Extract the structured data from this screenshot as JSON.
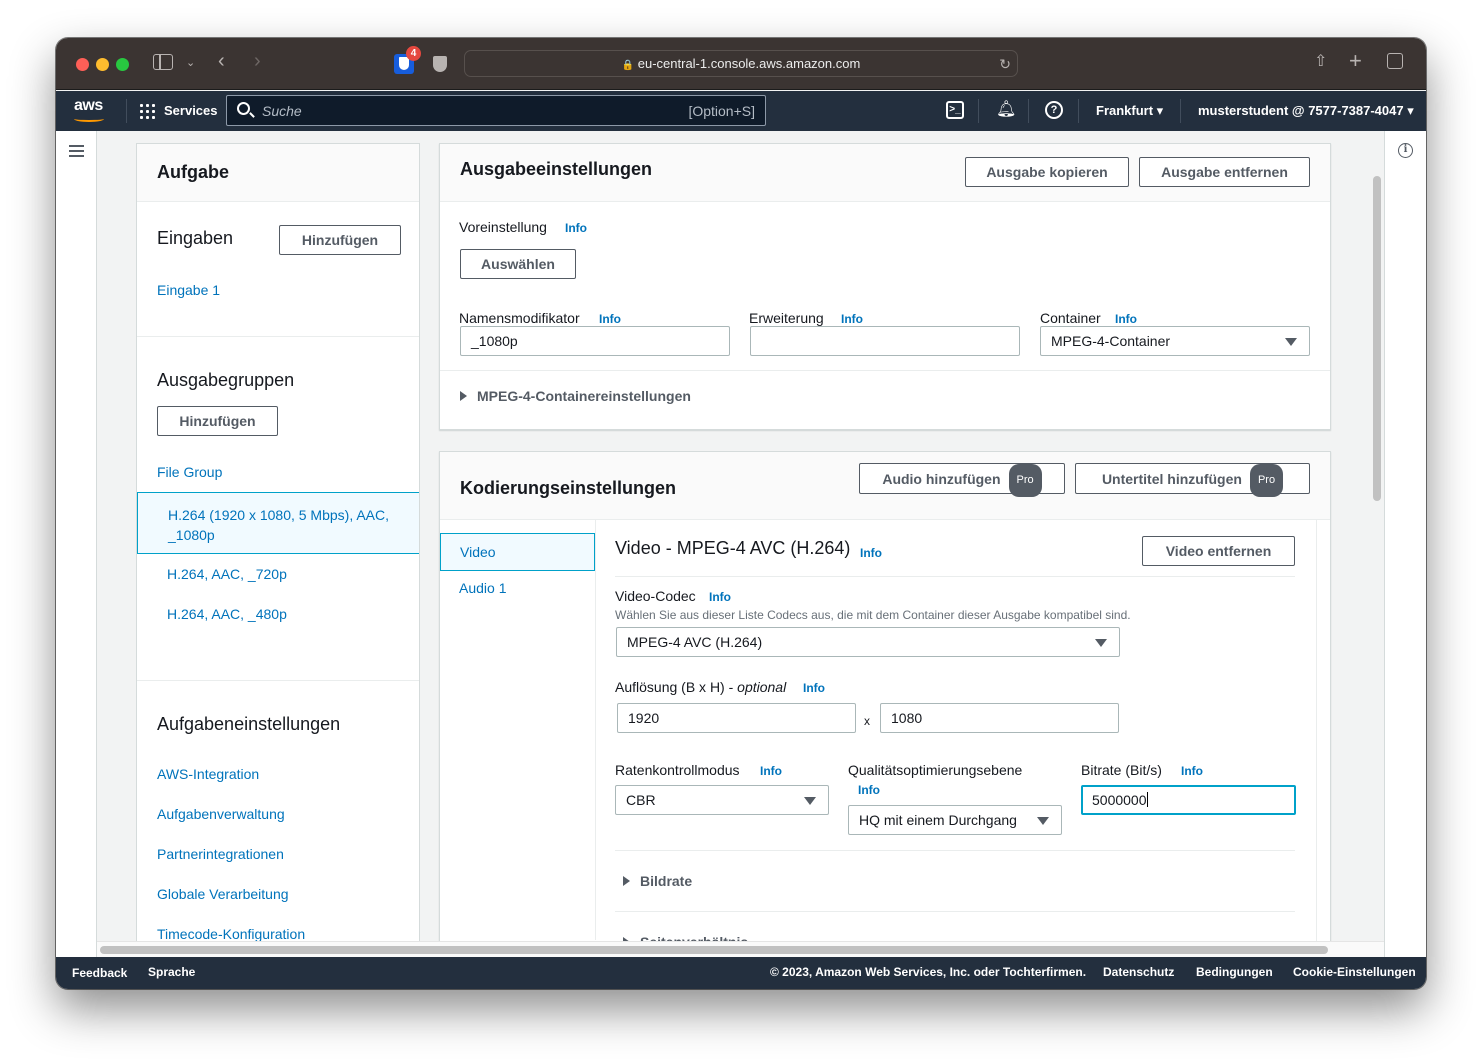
{
  "browser": {
    "url": "eu-central-1.console.aws.amazon.com",
    "extension_badge": "4"
  },
  "awsnav": {
    "logo": "aws",
    "services": "Services",
    "search_placeholder": "Suche",
    "search_shortcut": "[Option+S]",
    "region": "Frankfurt ▾",
    "account": "musterstudent @ 7577-7387-4047 ▾"
  },
  "left_panel": {
    "title": "Aufgabe",
    "inputs_heading": "Eingaben",
    "inputs_add": "Hinzufügen",
    "inputs": [
      "Eingabe 1"
    ],
    "output_groups_heading": "Ausgabegruppen",
    "output_groups_add": "Hinzufügen",
    "group_name": "File Group",
    "outputs": [
      {
        "label": "H.264 (1920 x 1080, 5 Mbps), AAC, _1080p",
        "line1": "H.264 (1920 x 1080, 5 Mbps), AAC,",
        "line2": "_1080p",
        "selected": true
      },
      {
        "label": "H.264, AAC, _720p",
        "selected": false
      },
      {
        "label": "H.264, AAC, _480p",
        "selected": false
      }
    ],
    "job_settings_heading": "Aufgabeneinstellungen",
    "job_settings": [
      "AWS-Integration",
      "Aufgabenverwaltung",
      "Partnerintegrationen",
      "Globale Verarbeitung",
      "Timecode-Konfiguration"
    ]
  },
  "output_settings": {
    "title": "Ausgabeeinstellungen",
    "copy_button": "Ausgabe kopieren",
    "remove_button": "Ausgabe entfernen",
    "preset_label": "Voreinstellung",
    "info": "Info",
    "preset_button": "Auswählen",
    "name_modifier_label": "Namensmodifikator",
    "name_modifier_value": "_1080p",
    "extension_label": "Erweiterung",
    "extension_value": "",
    "container_label": "Container",
    "container_value": "MPEG-4-Container",
    "container_settings": "MPEG-4-Containereinstellungen"
  },
  "encoding": {
    "title": "Kodierungseinstellungen",
    "add_audio": "Audio hinzufügen",
    "add_captions": "Untertitel hinzufügen",
    "pro_badge": "Pro",
    "tabs": [
      {
        "label": "Video",
        "active": true
      },
      {
        "label": "Audio 1",
        "active": false
      }
    ],
    "video_heading": "Video - MPEG-4 AVC (H.264)",
    "remove_video": "Video entfernen",
    "codec_label": "Video-Codec",
    "codec_hint": "Wählen Sie aus dieser Liste Codecs aus, die mit dem Container dieser Ausgabe kompatibel sind.",
    "codec_value": "MPEG-4 AVC (H.264)",
    "resolution_label": "Auflösung (B x H) - ",
    "resolution_optional": "optional",
    "width_value": "1920",
    "times": "x",
    "height_value": "1080",
    "rate_control_label": "Ratenkontrollmodus",
    "rate_control_value": "CBR",
    "quality_label": "Qualitätsoptimierungsebene",
    "quality_value": "HQ mit einem Durchgang",
    "bitrate_label": "Bitrate (Bit/s)",
    "bitrate_value": "5000000",
    "framerate": "Bildrate",
    "aspect_ratio": "Seitenverhältnis"
  },
  "footer": {
    "feedback": "Feedback",
    "language": "Sprache",
    "copyright": "© 2023, Amazon Web Services, Inc. oder Tochterfirmen.",
    "privacy": "Datenschutz",
    "terms": "Bedingungen",
    "cookies": "Cookie-Einstellungen"
  }
}
